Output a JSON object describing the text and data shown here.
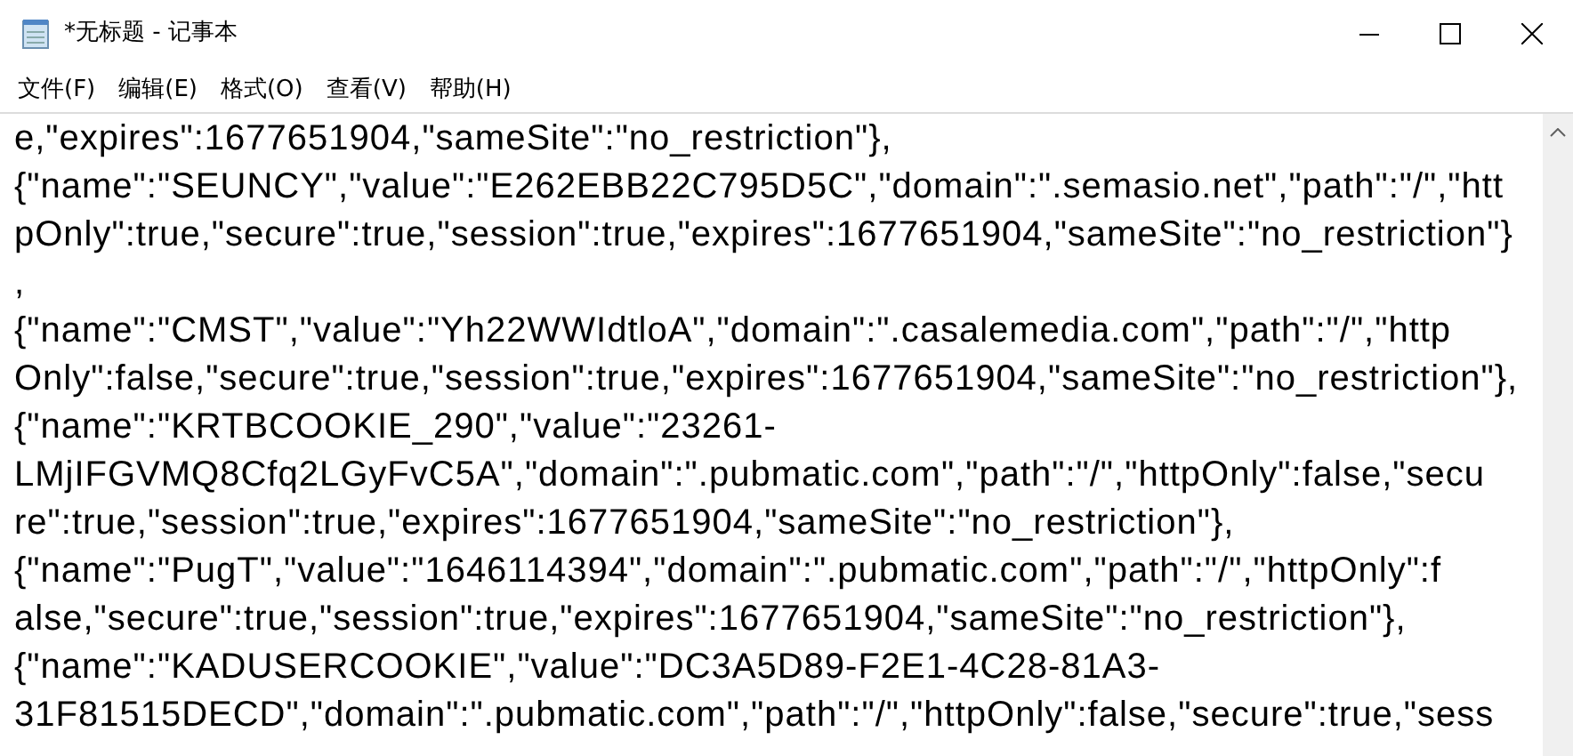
{
  "window": {
    "title": "*无标题 - 记事本"
  },
  "menu": [
    "文件(F)",
    "编辑(E)",
    "格式(O)",
    "查看(V)",
    "帮助(H)"
  ],
  "editor": {
    "lines": [
      "e,\"expires\":1677651904,\"sameSite\":\"no_restriction\"},",
      "{\"name\":\"SEUNCY\",\"value\":\"E262EBB22C795D5C\",\"domain\":\".semasio.net\",\"path\":\"/\",\"htt",
      "pOnly\":true,\"secure\":true,\"session\":true,\"expires\":1677651904,\"sameSite\":\"no_restriction\"}",
      ",",
      "{\"name\":\"CMST\",\"value\":\"Yh22WWIdtloA\",\"domain\":\".casalemedia.com\",\"path\":\"/\",\"http",
      "Only\":false,\"secure\":true,\"session\":true,\"expires\":1677651904,\"sameSite\":\"no_restriction\"},",
      "{\"name\":\"KRTBCOOKIE_290\",\"value\":\"23261-",
      "LMjIFGVMQ8Cfq2LGyFvC5A\",\"domain\":\".pubmatic.com\",\"path\":\"/\",\"httpOnly\":false,\"secu",
      "re\":true,\"session\":true,\"expires\":1677651904,\"sameSite\":\"no_restriction\"},",
      "{\"name\":\"PugT\",\"value\":\"1646114394\",\"domain\":\".pubmatic.com\",\"path\":\"/\",\"httpOnly\":f",
      "alse,\"secure\":true,\"session\":true,\"expires\":1677651904,\"sameSite\":\"no_restriction\"},",
      "{\"name\":\"KADUSERCOOKIE\",\"value\":\"DC3A5D89-F2E1-4C28-81A3-",
      "31F81515DECD\",\"domain\":\".pubmatic.com\",\"path\":\"/\",\"httpOnly\":false,\"secure\":true,\"sess"
    ]
  }
}
